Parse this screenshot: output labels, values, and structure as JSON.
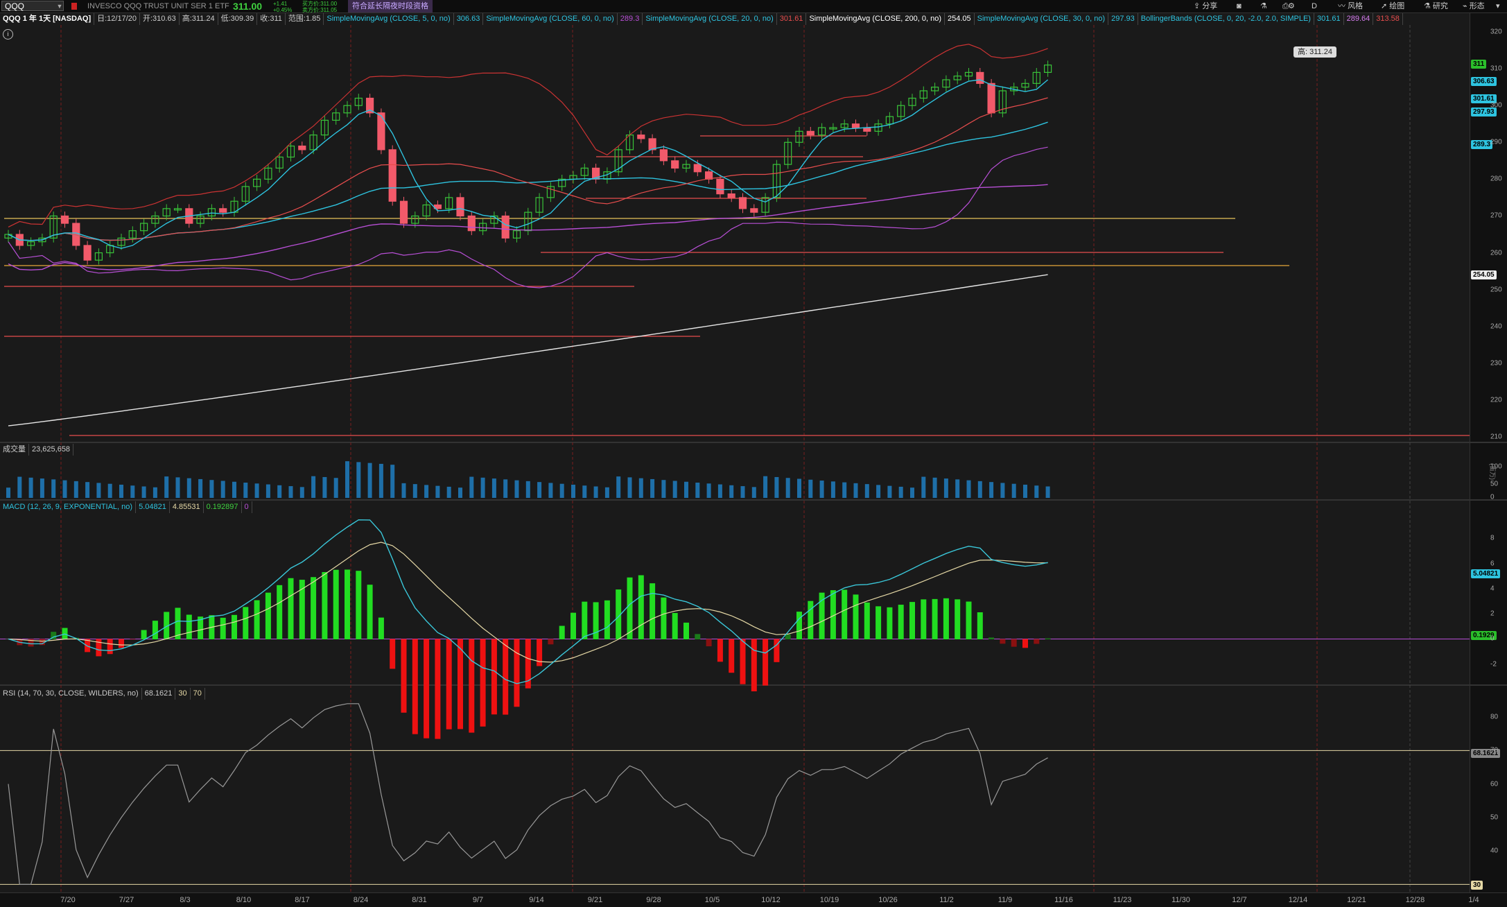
{
  "toolbar": {
    "symbol": "QQQ",
    "description": "INVESCO QQQ TRUST UNIT SER 1 ETF",
    "last_price": "311.00",
    "change_abs": "+1.41",
    "change_pct": "+0.45%",
    "bid": "买方价:311.00",
    "ask": "卖方价:311.05",
    "ext_hours_note": "符合延长隔夜时段资格",
    "share": "分享",
    "style": "风格",
    "draw": "绘图",
    "study": "研究",
    "pattern": "形态",
    "period": "D"
  },
  "header": {
    "title": "QQQ 1 年 1天 [NASDAQ]",
    "date": "日:12/17/20",
    "open": "开:310.63",
    "high": "高:311.24",
    "low": "低:309.39",
    "close": "收:311",
    "range": "范围:1.85",
    "sma5": "SimpleMovingAvg (CLOSE, 5, 0, no)",
    "sma5_val": "306.63",
    "sma60": "SimpleMovingAvg (CLOSE, 60, 0, no)",
    "sma60_val": "289.3",
    "sma20": "SimpleMovingAvg (CLOSE, 20, 0, no)",
    "sma20_val": "301.61",
    "sma200": "SimpleMovingAvg (CLOSE, 200, 0, no)",
    "sma200_val": "254.05",
    "sma30": "SimpleMovingAvg (CLOSE, 30, 0, no)",
    "sma30_val": "297.93",
    "bb": "BollingerBands (CLOSE, 0, 20, -2.0, 2.0, SIMPLE)",
    "bb_mid": "301.61",
    "bb_low": "289.64",
    "bb_up": "313.58",
    "high_label": "高: 311.24",
    "info_icon": "i"
  },
  "price_badges": {
    "last": "311",
    "sma5": "306.63",
    "sma20": "301.61",
    "sma30": "297.93",
    "sma60": "289.3",
    "sma200": "254.05"
  },
  "price_axis": [
    "320",
    "310",
    "300",
    "290",
    "280",
    "270",
    "260",
    "250",
    "240",
    "230",
    "220",
    "210"
  ],
  "volume": {
    "label": "成交量",
    "value": "23,625,658",
    "ticks": [
      "100",
      "50",
      "0"
    ],
    "unit": "(百万)"
  },
  "macd": {
    "label": "MACD (12, 26, 9, EXPONENTIAL, no)",
    "value": "5.04821",
    "avg": "4.85531",
    "diff": "0.192897",
    "zero": "0",
    "badge_value": "5.04821",
    "badge_diff": "0.1929",
    "ticks": [
      "8",
      "6",
      "4",
      "2",
      "0",
      "-2"
    ]
  },
  "rsi": {
    "label": "RSI (14, 70, 30, CLOSE, WILDERS, no)",
    "value": "68.1621",
    "os": "30",
    "ob": "70",
    "badge": "68.1621",
    "badge30": "30",
    "ticks": [
      "80",
      "70",
      "60",
      "50",
      "40"
    ]
  },
  "x_axis": [
    "7/20",
    "7/27",
    "8/3",
    "8/10",
    "8/17",
    "8/24",
    "8/31",
    "9/7",
    "9/14",
    "9/21",
    "9/28",
    "10/5",
    "10/12",
    "10/19",
    "10/26",
    "11/2",
    "11/9",
    "11/16",
    "11/23",
    "11/30",
    "12/7",
    "12/14",
    "12/21",
    "12/28",
    "1/4"
  ],
  "colors": {
    "up": "#39c439",
    "down": "#f25a6a",
    "sma5": "#2ec4e0",
    "sma20": "#e84d4d",
    "bb": "#cc3333",
    "sma60": "#b84fd6",
    "sma200": "#e6e6e6",
    "macd_line": "#3ac6d8",
    "macd_avg": "#e6d9a6",
    "vol": "#1e6fa8"
  },
  "chart_data": {
    "type": "candlestick",
    "closes": [
      265,
      262,
      263,
      264,
      270,
      268,
      262,
      258,
      260,
      262,
      264,
      266,
      268,
      270,
      272,
      272,
      268,
      270,
      272,
      271,
      274,
      278,
      280,
      283,
      286,
      289,
      288,
      292,
      296,
      298,
      300,
      302,
      298,
      288,
      274,
      268,
      270,
      273,
      272,
      275,
      270,
      266,
      268,
      270,
      264,
      266,
      271,
      275,
      278,
      280,
      281,
      283,
      280,
      282,
      288,
      292,
      291,
      288,
      285,
      283,
      284,
      282,
      280,
      276,
      275,
      272,
      271,
      275,
      284,
      290,
      293,
      292,
      294,
      294,
      295,
      294,
      293,
      295,
      297,
      300,
      302,
      304,
      305,
      307,
      308,
      309,
      306,
      298,
      304,
      305,
      306,
      309,
      311
    ],
    "ylim": [
      210,
      320
    ],
    "sma200_start": 213,
    "sma200_end": 254.05,
    "macd_ylim": [
      -3.5,
      10
    ],
    "rsi_ylim": [
      28,
      85
    ]
  }
}
